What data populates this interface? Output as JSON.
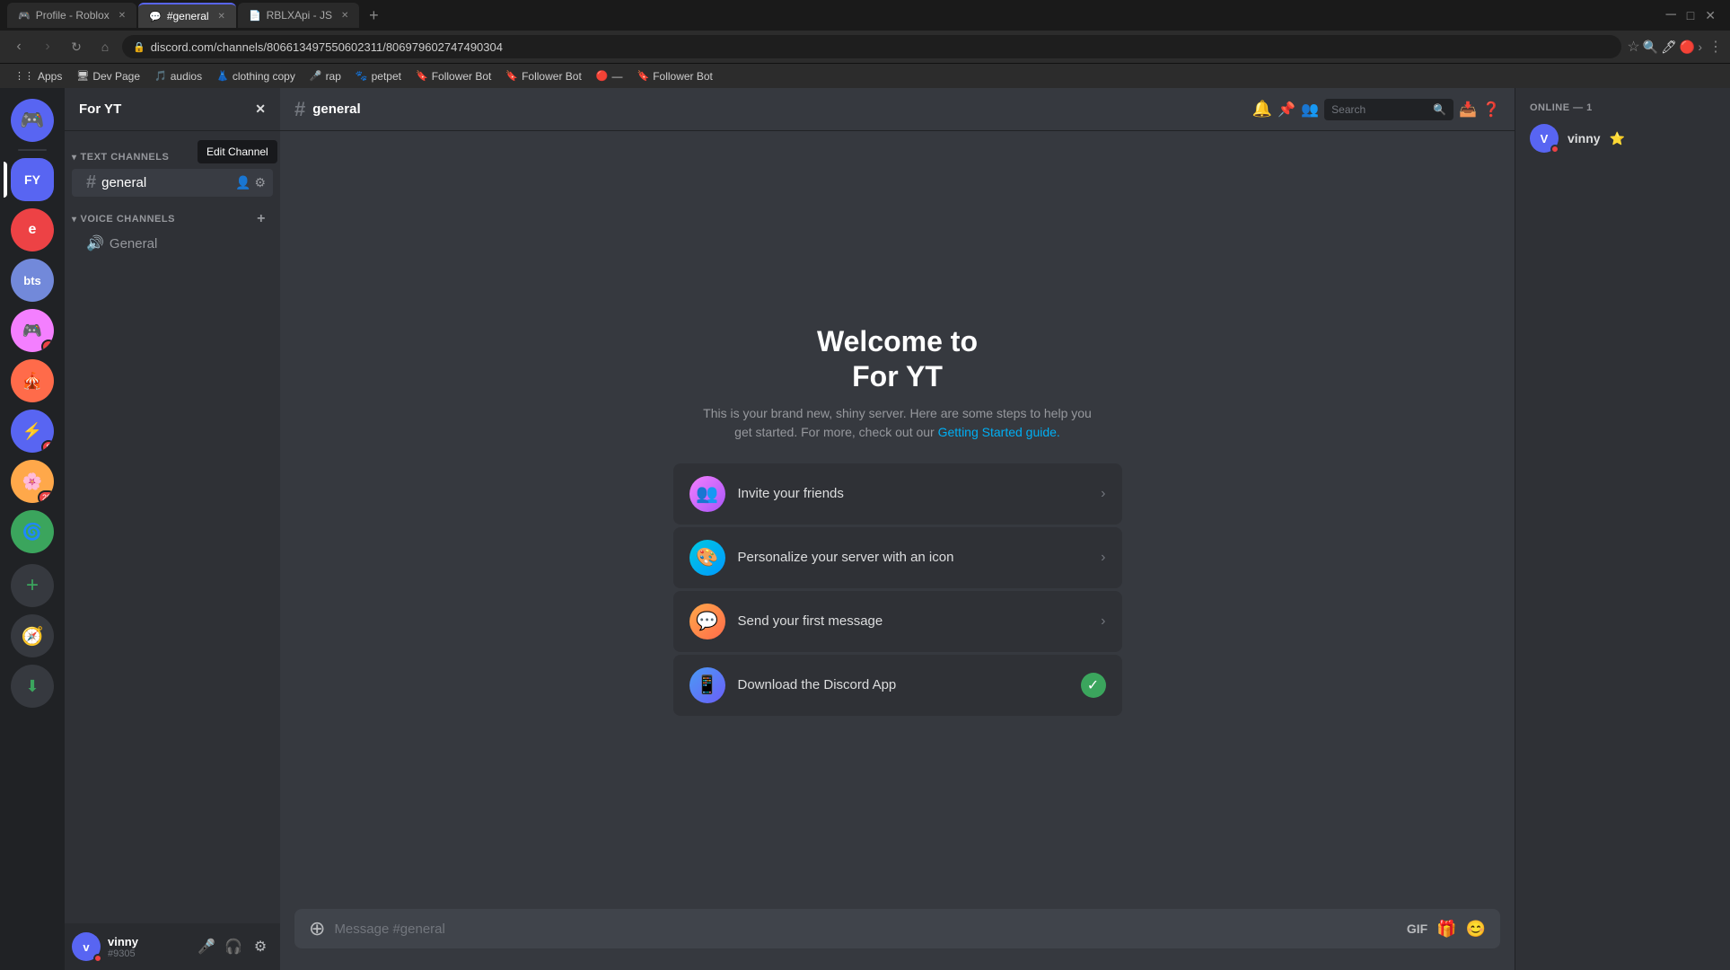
{
  "browser": {
    "tabs": [
      {
        "id": "tab-roblox",
        "favicon": "🎮",
        "label": "Profile - Roblox",
        "active": false,
        "url": ""
      },
      {
        "id": "tab-discord",
        "favicon": "💬",
        "label": "#general",
        "active": true,
        "url": "discord.com/channels/806613497550602311/806979602747490304"
      },
      {
        "id": "tab-js",
        "favicon": "📄",
        "label": "RBLXApi - JS",
        "active": false,
        "url": ""
      }
    ],
    "address": "discord.com/channels/806613497550602311/806979602747490304",
    "bookmarks": [
      {
        "id": "bm-apps",
        "favicon": "⋮⋮",
        "label": "Apps"
      },
      {
        "id": "bm-devpage",
        "favicon": "🖥",
        "label": "Dev Page"
      },
      {
        "id": "bm-audios",
        "favicon": "🎵",
        "label": "audios"
      },
      {
        "id": "bm-clothing",
        "favicon": "👗",
        "label": "clothing copy"
      },
      {
        "id": "bm-rap",
        "favicon": "🎤",
        "label": "rap"
      },
      {
        "id": "bm-petpet",
        "favicon": "🐾",
        "label": "petpet"
      },
      {
        "id": "bm-followerbot1",
        "favicon": "🔖",
        "label": "Follower Bot"
      },
      {
        "id": "bm-followerbot2",
        "favicon": "🔖",
        "label": "Follower Bot"
      },
      {
        "id": "bm-hash",
        "favicon": "#",
        "label": "— "
      },
      {
        "id": "bm-followerbot3",
        "favicon": "🔖",
        "label": "Follower Bot"
      }
    ]
  },
  "discord": {
    "servers": [
      {
        "id": "home",
        "label": "Discord Home",
        "icon": "🎮",
        "type": "home",
        "class": "discord-home"
      },
      {
        "id": "fy",
        "label": "For YT",
        "initials": "FY",
        "class": "sv-fy",
        "active": true
      },
      {
        "id": "e",
        "label": "e",
        "initials": "e",
        "class": "sv-e"
      },
      {
        "id": "bts",
        "label": "bts",
        "initials": "bts",
        "class": "sv-bts"
      },
      {
        "id": "s1",
        "label": "Server 1",
        "initials": "",
        "class": "sv-1",
        "badge": ""
      },
      {
        "id": "s2",
        "label": "Server 2",
        "initials": "",
        "class": "sv-2",
        "badge": ""
      },
      {
        "id": "s3",
        "label": "Server 3",
        "initials": "",
        "class": "sv-3",
        "badge": "8"
      },
      {
        "id": "s4",
        "label": "Server 4",
        "initials": "",
        "class": "sv-4",
        "badge": "29"
      },
      {
        "id": "s5",
        "label": "Server 5",
        "initials": "",
        "class": "sv-5"
      }
    ],
    "server_name": "For YT",
    "channel": {
      "name": "general",
      "id": "general"
    },
    "text_channels_label": "TEXT CHANNELS",
    "voice_channels_label": "VOICE CHANNELS",
    "channels": {
      "text": [
        {
          "id": "general",
          "name": "general",
          "active": true
        }
      ],
      "voice": [
        {
          "id": "general-voice",
          "name": "General"
        }
      ]
    },
    "edit_channel_tooltip": "Edit Channel",
    "welcome": {
      "title_line1": "Welcome to",
      "title_line2": "For YT",
      "subtitle": "This is your brand new, shiny server. Here are some steps to help you get started. For more, check out our",
      "subtitle_link": "Getting Started guide.",
      "actions": [
        {
          "id": "invite",
          "label": "Invite your friends",
          "icon": "👥",
          "icon_class": "invite",
          "completed": false
        },
        {
          "id": "personalize",
          "label": "Personalize your server with an icon",
          "icon": "🎨",
          "icon_class": "personalize",
          "completed": false
        },
        {
          "id": "message",
          "label": "Send your first message",
          "icon": "💬",
          "icon_class": "message",
          "completed": false
        },
        {
          "id": "download",
          "label": "Download the Discord App",
          "icon": "📱",
          "icon_class": "download",
          "completed": true
        }
      ]
    },
    "message_placeholder": "Message #general",
    "online_label": "ONLINE — 1",
    "members": [
      {
        "id": "vinny",
        "name": "vinny",
        "badge": "⭐",
        "status": "dnd"
      }
    ],
    "user": {
      "name": "vinny",
      "tag": "#9305",
      "initials": "v"
    },
    "header": {
      "notification_icon": "🔔",
      "pin_icon": "📌",
      "members_icon": "👥",
      "search_placeholder": "Search"
    }
  }
}
